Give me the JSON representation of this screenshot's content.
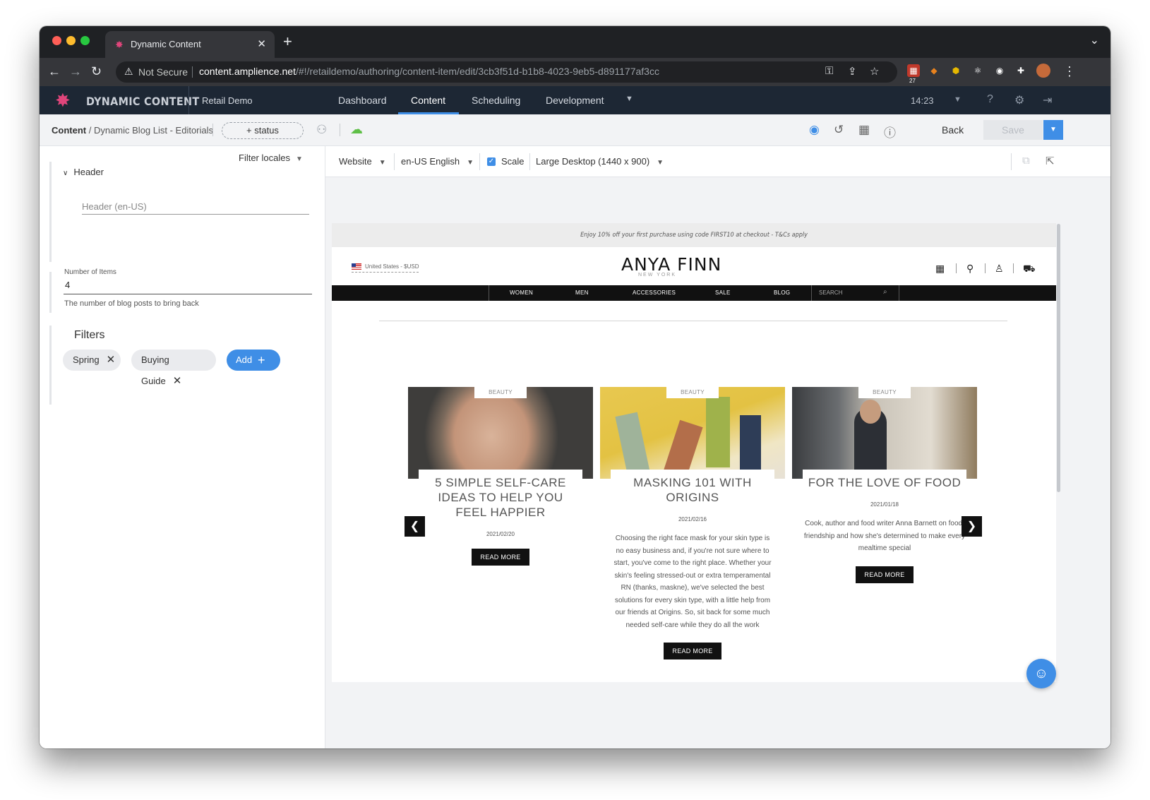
{
  "browser": {
    "tab_title": "Dynamic Content",
    "url_host": "content.amplience.net",
    "url_path": "/#!/retaildemo/authoring/content-item/edit/3cb3f51d-b1b8-4023-9eb5-d891177af3cc",
    "security_label": "Not Secure",
    "extension_badge": "27"
  },
  "app_header": {
    "brand": "DYNAMIC CONTENT",
    "hub": "Retail Demo",
    "nav": [
      "Dashboard",
      "Content",
      "Scheduling",
      "Development"
    ],
    "active_nav": "Content",
    "time": "14:23"
  },
  "subbar": {
    "breadcrumb_root": "Content",
    "breadcrumb_item": "/ Dynamic Blog List - Editorials",
    "status_label": "+ status",
    "back_label": "Back",
    "save_label": "Save"
  },
  "form": {
    "filter_locales": "Filter locales",
    "header_section": "Header",
    "header_placeholder": "Header (en-US)",
    "items_label": "Number of Items",
    "items_value": "4",
    "items_help": "The number of blog posts to bring back",
    "filters_title": "Filters",
    "filter_chips": [
      "Spring",
      "Buying Guide"
    ],
    "add_label": "Add"
  },
  "preview_toolbar": {
    "channel": "Website",
    "locale": "en-US English",
    "scale_label": "Scale",
    "scale_checked": true,
    "device": "Large Desktop (1440 x 900)"
  },
  "site": {
    "promo": "Enjoy 10% off your first purchase using code FIRST10 at checkout - T&Cs apply",
    "country": "United States - $USD",
    "logo": "ANYA FINN",
    "logo_sub": "NEW YORK",
    "nav": [
      "WOMEN",
      "MEN",
      "ACCESSORIES",
      "SALE",
      "BLOG"
    ],
    "search_placeholder": "SEARCH",
    "read_more": "READ MORE",
    "cards": [
      {
        "tag": "BEAUTY",
        "title": "5 SIMPLE SELF-CARE IDEAS TO HELP YOU FEEL HAPPIER",
        "date": "2021/02/20",
        "excerpt": ""
      },
      {
        "tag": "BEAUTY",
        "title": "MASKING 101 WITH ORIGINS",
        "date": "2021/02/16",
        "excerpt": "Choosing the right face mask for your skin type is no easy business and, if you're not sure where to start, you've come to the right place. Whether your skin's feeling stressed-out or extra temperamental RN (thanks, maskne), we've selected the best solutions for every skin type, with a little help from our friends at Origins. So, sit back for some much needed self-care while they do all the work"
      },
      {
        "tag": "BEAUTY",
        "title": "FOR THE LOVE OF FOOD",
        "date": "2021/01/18",
        "excerpt": "Cook, author and food writer Anna Barnett on food, friendship and how she's determined to make every mealtime special"
      }
    ]
  },
  "colors": {
    "accent": "#3f8ee6",
    "app_header_bg": "#1d2734",
    "brand_pink": "#e0457b",
    "cloud_green": "#5fbf47"
  }
}
